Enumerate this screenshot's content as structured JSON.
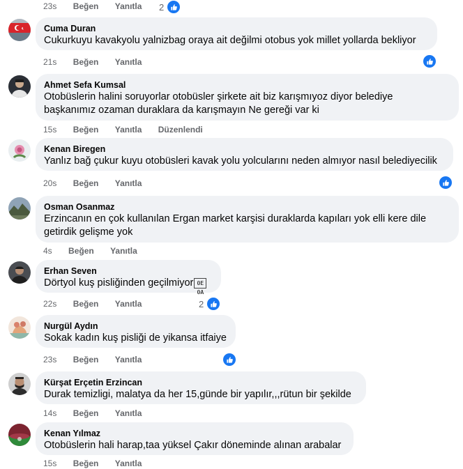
{
  "actions": {
    "like": "Beğen",
    "reply": "Yanıtla",
    "edited": "Düzenlendi"
  },
  "top": {
    "time": "23s",
    "reaction_count": "2"
  },
  "comments": [
    {
      "author": "Cuma Duran",
      "text": "Cukurkuyu kavakyolu yalnizbag oraya ait değilmi otobus yok millet yollarda bekliyor",
      "time": "21s"
    },
    {
      "author": "Ahmet Sefa Kumsal",
      "text": "Otobüslerin halini soruyorlar otobüsler şirkete ait biz karışmıyoz diyor belediye",
      "text2": "başkanımız ozaman duraklara da karışmayın Ne gereği var ki",
      "time": "15s"
    },
    {
      "author": "Kenan Biregen",
      "text": "Yanlız bağ çukur kuyu otobüsleri kavak yolu yolcularını neden almıyor nasıl belediyecilik",
      "time": "20s"
    },
    {
      "author": "Osman Osanmaz",
      "text": "Erzincanın en çok kullanılan Ergan market karşisi duraklarda kapıları yok elli kere dile",
      "text2": "getirdik gelişme yok",
      "time": "4s"
    },
    {
      "author": "Erhan Seven",
      "text": "Dörtyol kuş pisliğinden geçilmiyor",
      "emoji_code": "0E 0A",
      "time": "22s",
      "reaction_count": "2"
    },
    {
      "author": "Nurgül Aydın",
      "text": "Sokak kadın kuş pisliği de yikansa itfaiye",
      "time": "23s"
    },
    {
      "author": "Kürşat Erçetin Erzincan",
      "text": "Durak temizligi, malatya da her 15,günde bir yapılır,,,rütun bir şekilde",
      "time": "14s"
    },
    {
      "author": "Kenan Yılmaz",
      "text": "Otobüslerin hali harap,taa yüksel Çakır döneminde alınan arabalar",
      "time": "15s"
    }
  ],
  "colors": {
    "like_blue": "#1877f2",
    "bubble": "#f0f2f5",
    "meta": "#65676b"
  }
}
